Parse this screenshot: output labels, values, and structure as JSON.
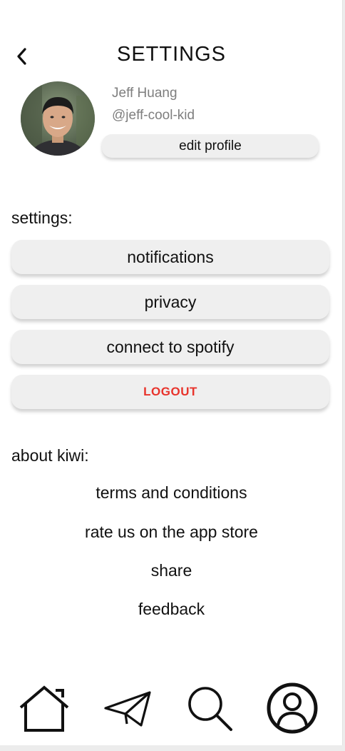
{
  "header": {
    "title": "SETTINGS",
    "back_icon": "chevron-left-icon"
  },
  "profile": {
    "name": "Jeff Huang",
    "handle": "@jeff-cool-kid",
    "edit_label": "edit profile"
  },
  "settings_section": {
    "label": "settings:",
    "items": [
      {
        "label": "notifications"
      },
      {
        "label": "privacy"
      },
      {
        "label": "connect to spotify"
      }
    ],
    "logout_label": "LOGOUT"
  },
  "about_section": {
    "label": "about kiwi:",
    "links": [
      {
        "label": "terms and conditions"
      },
      {
        "label": "rate us on the app store"
      },
      {
        "label": "share"
      },
      {
        "label": "feedback"
      }
    ]
  },
  "bottom_nav": {
    "items": [
      {
        "icon": "home-icon"
      },
      {
        "icon": "paper-plane-icon"
      },
      {
        "icon": "search-icon"
      },
      {
        "icon": "profile-icon"
      }
    ]
  },
  "colors": {
    "logout": "#e8332b",
    "button_bg": "#efefef",
    "muted_text": "#7e7e7e"
  }
}
